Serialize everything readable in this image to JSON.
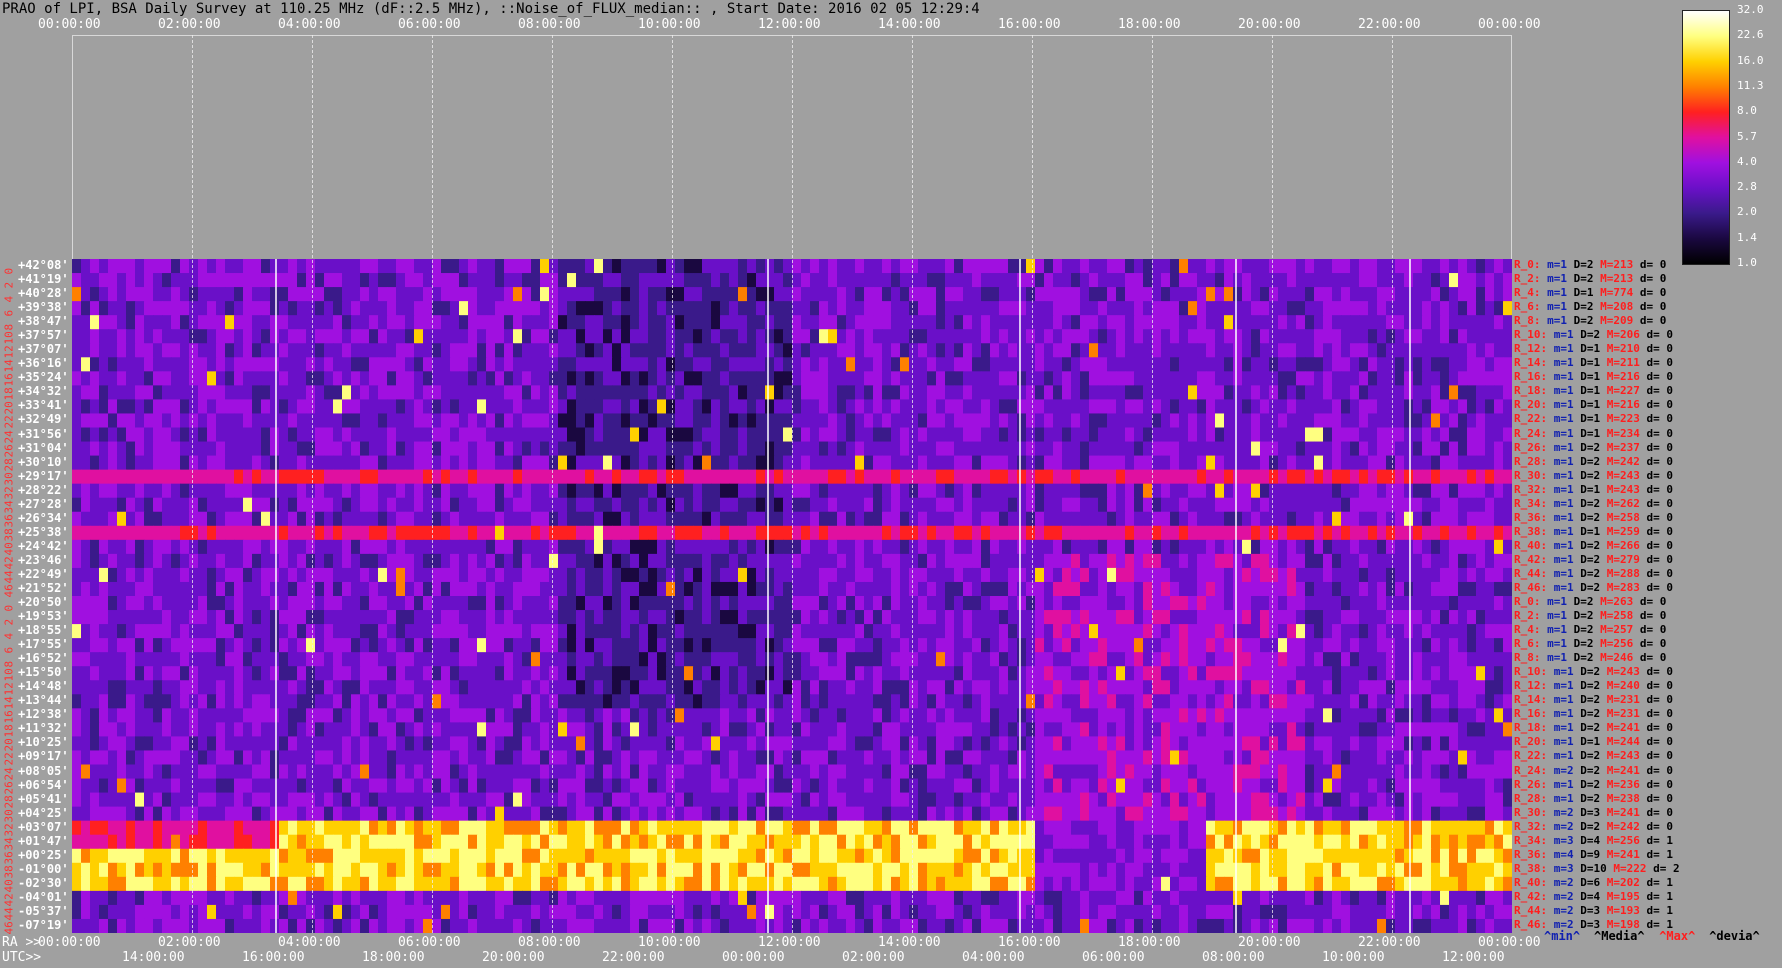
{
  "title": "PRAO of LPI, BSA Daily Survey at 110.25 MHz (dF::2.5 MHz), ::Noise_of_FLUX_median:: , Start Date: 2016 02 05 12:29:4",
  "chart_data": {
    "type": "heatmap",
    "title": "PRAO of LPI, BSA Daily Survey at 110.25 MHz (dF::2.5 MHz), ::Noise_of_FLUX_median:: , Start Date: 2016 02 05 12:29:4",
    "top_axis_ticks": [
      "00:00:00",
      "02:00:00",
      "04:00:00",
      "06:00:00",
      "08:00:00",
      "10:00:00",
      "12:00:00",
      "14:00:00",
      "16:00:00",
      "18:00:00",
      "20:00:00",
      "22:00:00",
      "00:00:00"
    ],
    "ra_axis_label": "RA >>",
    "ra_ticks": [
      "00:00:00",
      "02:00:00",
      "04:00:00",
      "06:00:00",
      "08:00:00",
      "10:00:00",
      "12:00:00",
      "14:00:00",
      "16:00:00",
      "18:00:00",
      "20:00:00",
      "22:00:00",
      "00:00:00"
    ],
    "utc_axis_label": "UTC>>",
    "utc_ticks": [
      "14:00:00",
      "16:00:00",
      "18:00:00",
      "20:00:00",
      "22:00:00",
      "00:00:00",
      "02:00:00",
      "04:00:00",
      "06:00:00",
      "08:00:00",
      "10:00:00",
      "12:00:00"
    ],
    "colorbar_ticks": [
      "32.0",
      "22.6",
      "16.0",
      "11.3",
      "8.0",
      "5.7",
      "4.0",
      "2.8",
      "2.0",
      "1.4",
      "1.0"
    ],
    "colors": [
      "#000000",
      "#1a0840",
      "#3a1a8a",
      "#6a10c8",
      "#a010e0",
      "#e010a0",
      "#ff2020",
      "#ff8000",
      "#ffd000",
      "#ffff80",
      "#ffffff"
    ],
    "declinations": [
      "+42°08'",
      "+41°19'",
      "+40°28'",
      "+39°38'",
      "+38°47'",
      "+37°57'",
      "+37°07'",
      "+36°16'",
      "+35°24'",
      "+34°32'",
      "+33°41'",
      "+32°49'",
      "+31°56'",
      "+31°04'",
      "+30°10'",
      "+29°17'",
      "+28°22'",
      "+27°28'",
      "+26°34'",
      "+25°38'",
      "+24°42'",
      "+23°46'",
      "+22°49'",
      "+21°52'",
      "+20°50'",
      "+19°53'",
      "+18°55'",
      "+17°55'",
      "+16°52'",
      "+15°50'",
      "+14°48'",
      "+13°44'",
      "+12°38'",
      "+11°32'",
      "+10°25'",
      "+09°17'",
      "+08°05'",
      "+06°54'",
      "+05°41'",
      "+04°25'",
      "+03°07'",
      "+01°47'",
      "+00°25'",
      "-01°00'",
      "-02°30'",
      "-04°01'",
      "-05°37'",
      "-07°19'"
    ],
    "row_indices": [
      "0",
      "2",
      "4",
      "6",
      "8",
      "10",
      "12",
      "14",
      "16",
      "18",
      "20",
      "22",
      "24",
      "26",
      "28",
      "30",
      "32",
      "34",
      "36",
      "38",
      "40",
      "42",
      "44",
      "46",
      "0",
      "2",
      "4",
      "6",
      "8",
      "10",
      "12",
      "14",
      "16",
      "18",
      "20",
      "22",
      "24",
      "26",
      "28",
      "30",
      "32",
      "34",
      "36",
      "38",
      "40",
      "42",
      "44",
      "46"
    ],
    "row_stats": [
      {
        "r": "R_0:",
        "m": "m=1",
        "d": "D=2",
        "M": "M=213",
        "dev": "d= 0"
      },
      {
        "r": "R_2:",
        "m": "m=1",
        "d": "D=2",
        "M": "M=213",
        "dev": "d= 0"
      },
      {
        "r": "R_4:",
        "m": "m=1",
        "d": "D=1",
        "M": "M=774",
        "dev": "d= 0"
      },
      {
        "r": "R_6:",
        "m": "m=1",
        "d": "D=2",
        "M": "M=208",
        "dev": "d= 0"
      },
      {
        "r": "R_8:",
        "m": "m=1",
        "d": "D=2",
        "M": "M=209",
        "dev": "d= 0"
      },
      {
        "r": "R_10:",
        "m": "m=1",
        "d": "D=2",
        "M": "M=206",
        "dev": "d= 0"
      },
      {
        "r": "R_12:",
        "m": "m=1",
        "d": "D=1",
        "M": "M=210",
        "dev": "d= 0"
      },
      {
        "r": "R_14:",
        "m": "m=1",
        "d": "D=1",
        "M": "M=211",
        "dev": "d= 0"
      },
      {
        "r": "R_16:",
        "m": "m=1",
        "d": "D=1",
        "M": "M=216",
        "dev": "d= 0"
      },
      {
        "r": "R_18:",
        "m": "m=1",
        "d": "D=1",
        "M": "M=227",
        "dev": "d= 0"
      },
      {
        "r": "R_20:",
        "m": "m=1",
        "d": "D=1",
        "M": "M=216",
        "dev": "d= 0"
      },
      {
        "r": "R_22:",
        "m": "m=1",
        "d": "D=1",
        "M": "M=223",
        "dev": "d= 0"
      },
      {
        "r": "R_24:",
        "m": "m=1",
        "d": "D=1",
        "M": "M=234",
        "dev": "d= 0"
      },
      {
        "r": "R_26:",
        "m": "m=1",
        "d": "D=2",
        "M": "M=237",
        "dev": "d= 0"
      },
      {
        "r": "R_28:",
        "m": "m=1",
        "d": "D=2",
        "M": "M=242",
        "dev": "d= 0"
      },
      {
        "r": "R_30:",
        "m": "m=1",
        "d": "D=2",
        "M": "M=243",
        "dev": "d= 0"
      },
      {
        "r": "R_32:",
        "m": "m=1",
        "d": "D=1",
        "M": "M=243",
        "dev": "d= 0"
      },
      {
        "r": "R_34:",
        "m": "m=1",
        "d": "D=2",
        "M": "M=262",
        "dev": "d= 0"
      },
      {
        "r": "R_36:",
        "m": "m=1",
        "d": "D=2",
        "M": "M=258",
        "dev": "d= 0"
      },
      {
        "r": "R_38:",
        "m": "m=1",
        "d": "D=1",
        "M": "M=259",
        "dev": "d= 0"
      },
      {
        "r": "R_40:",
        "m": "m=1",
        "d": "D=2",
        "M": "M=266",
        "dev": "d= 0"
      },
      {
        "r": "R_42:",
        "m": "m=1",
        "d": "D=2",
        "M": "M=279",
        "dev": "d= 0"
      },
      {
        "r": "R_44:",
        "m": "m=1",
        "d": "D=2",
        "M": "M=288",
        "dev": "d= 0"
      },
      {
        "r": "R_46:",
        "m": "m=1",
        "d": "D=2",
        "M": "M=283",
        "dev": "d= 0"
      },
      {
        "r": "R_0:",
        "m": "m=1",
        "d": "D=2",
        "M": "M=263",
        "dev": "d= 0"
      },
      {
        "r": "R_2:",
        "m": "m=1",
        "d": "D=2",
        "M": "M=258",
        "dev": "d= 0"
      },
      {
        "r": "R_4:",
        "m": "m=1",
        "d": "D=2",
        "M": "M=257",
        "dev": "d= 0"
      },
      {
        "r": "R_6:",
        "m": "m=1",
        "d": "D=2",
        "M": "M=256",
        "dev": "d= 0"
      },
      {
        "r": "R_8:",
        "m": "m=1",
        "d": "D=2",
        "M": "M=246",
        "dev": "d= 0"
      },
      {
        "r": "R_10:",
        "m": "m=1",
        "d": "D=2",
        "M": "M=243",
        "dev": "d= 0"
      },
      {
        "r": "R_12:",
        "m": "m=1",
        "d": "D=2",
        "M": "M=240",
        "dev": "d= 0"
      },
      {
        "r": "R_14:",
        "m": "m=1",
        "d": "D=2",
        "M": "M=231",
        "dev": "d= 0"
      },
      {
        "r": "R_16:",
        "m": "m=1",
        "d": "D=2",
        "M": "M=231",
        "dev": "d= 0"
      },
      {
        "r": "R_18:",
        "m": "m=1",
        "d": "D=2",
        "M": "M=241",
        "dev": "d= 0"
      },
      {
        "r": "R_20:",
        "m": "m=1",
        "d": "D=1",
        "M": "M=244",
        "dev": "d= 0"
      },
      {
        "r": "R_22:",
        "m": "m=1",
        "d": "D=2",
        "M": "M=243",
        "dev": "d= 0"
      },
      {
        "r": "R_24:",
        "m": "m=2",
        "d": "D=2",
        "M": "M=241",
        "dev": "d= 0"
      },
      {
        "r": "R_26:",
        "m": "m=1",
        "d": "D=2",
        "M": "M=236",
        "dev": "d= 0"
      },
      {
        "r": "R_28:",
        "m": "m=1",
        "d": "D=2",
        "M": "M=238",
        "dev": "d= 0"
      },
      {
        "r": "R_30:",
        "m": "m=2",
        "d": "D=3",
        "M": "M=241",
        "dev": "d= 0"
      },
      {
        "r": "R_32:",
        "m": "m=2",
        "d": "D=2",
        "M": "M=242",
        "dev": "d= 0"
      },
      {
        "r": "R_34:",
        "m": "m=3",
        "d": "D=4",
        "M": "M=256",
        "dev": "d= 1"
      },
      {
        "r": "R_36:",
        "m": "m=4",
        "d": "D=9",
        "M": "M=241",
        "dev": "d= 1"
      },
      {
        "r": "R_38:",
        "m": "m=3",
        "d": "D=10",
        "M": "M=222",
        "dev": "d= 2"
      },
      {
        "r": "R_40:",
        "m": "m=2",
        "d": "D=6",
        "M": "M=202",
        "dev": "d= 1"
      },
      {
        "r": "R_42:",
        "m": "m=2",
        "d": "D=4",
        "M": "M=195",
        "dev": "d= 1"
      },
      {
        "r": "R_44:",
        "m": "m=2",
        "d": "D=3",
        "M": "M=193",
        "dev": "d= 1"
      },
      {
        "r": "R_46:",
        "m": "m=2",
        "d": "D=3",
        "M": "M=198",
        "dev": "d= 1"
      }
    ],
    "legend": [
      {
        "text": "^min^",
        "color": "#1020b0"
      },
      {
        "text": "^Media^",
        "color": "#000000"
      },
      {
        "text": "^Max^",
        "color": "#ff1e1e"
      },
      {
        "text": "^devia^",
        "color": "#000000"
      }
    ],
    "grid": true
  }
}
